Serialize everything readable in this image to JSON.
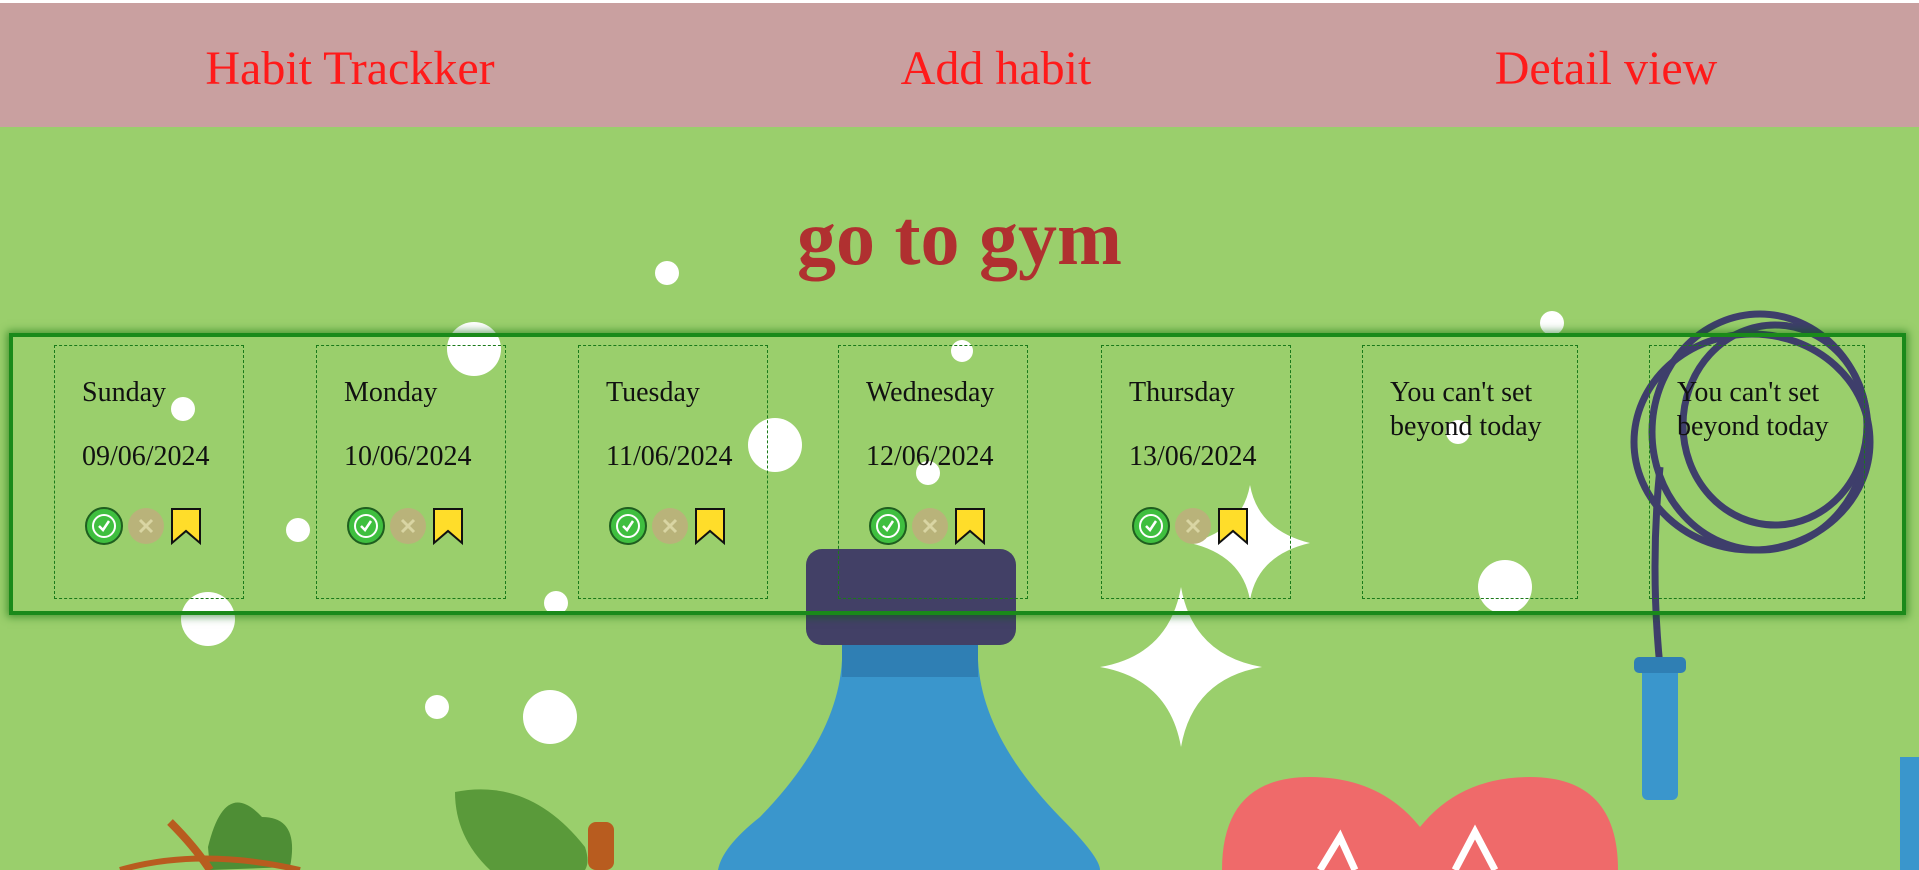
{
  "nav": {
    "home": "Habit Trackker",
    "add": "Add habit",
    "detail": "Detail view"
  },
  "habit": {
    "title": "go to gym"
  },
  "days": [
    {
      "day": "Sunday",
      "date": "09/06/2024"
    },
    {
      "day": "Monday",
      "date": "10/06/2024"
    },
    {
      "day": "Tuesday",
      "date": "11/06/2024"
    },
    {
      "day": "Wednesday",
      "date": "12/06/2024"
    },
    {
      "day": "Thursday",
      "date": "13/06/2024"
    },
    {
      "message": "You can't set beyond today"
    },
    {
      "message": "You can't set beyond today"
    }
  ],
  "icons": {
    "done": "check-circle-icon",
    "not_done": "x-circle-icon",
    "none": "bookmark-icon"
  },
  "colors": {
    "nav_bg": "#c9a0a0",
    "nav_text": "#ff1a1a",
    "page_bg": "#9acf6c",
    "title": "#b03030",
    "border": "#1a8a1a",
    "check": "#3fbf3f",
    "bookmark": "#ffdd2a"
  }
}
